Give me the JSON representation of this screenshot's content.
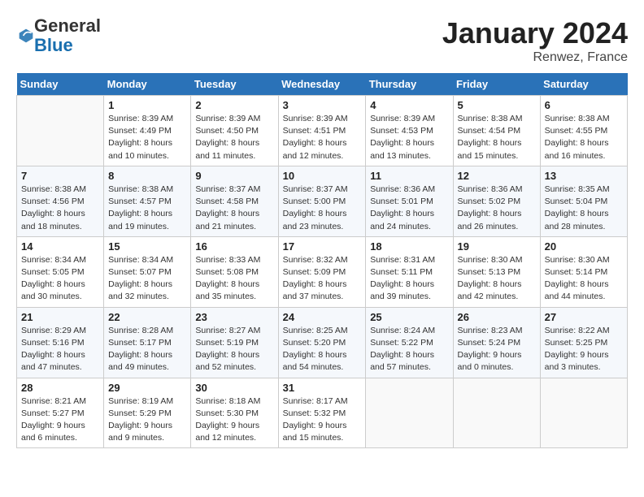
{
  "logo": {
    "general": "General",
    "blue": "Blue"
  },
  "header": {
    "month": "January 2024",
    "location": "Renwez, France"
  },
  "weekdays": [
    "Sunday",
    "Monday",
    "Tuesday",
    "Wednesday",
    "Thursday",
    "Friday",
    "Saturday"
  ],
  "weeks": [
    [
      {
        "day": "",
        "sunrise": "",
        "sunset": "",
        "daylight": ""
      },
      {
        "day": "1",
        "sunrise": "Sunrise: 8:39 AM",
        "sunset": "Sunset: 4:49 PM",
        "daylight": "Daylight: 8 hours and 10 minutes."
      },
      {
        "day": "2",
        "sunrise": "Sunrise: 8:39 AM",
        "sunset": "Sunset: 4:50 PM",
        "daylight": "Daylight: 8 hours and 11 minutes."
      },
      {
        "day": "3",
        "sunrise": "Sunrise: 8:39 AM",
        "sunset": "Sunset: 4:51 PM",
        "daylight": "Daylight: 8 hours and 12 minutes."
      },
      {
        "day": "4",
        "sunrise": "Sunrise: 8:39 AM",
        "sunset": "Sunset: 4:53 PM",
        "daylight": "Daylight: 8 hours and 13 minutes."
      },
      {
        "day": "5",
        "sunrise": "Sunrise: 8:38 AM",
        "sunset": "Sunset: 4:54 PM",
        "daylight": "Daylight: 8 hours and 15 minutes."
      },
      {
        "day": "6",
        "sunrise": "Sunrise: 8:38 AM",
        "sunset": "Sunset: 4:55 PM",
        "daylight": "Daylight: 8 hours and 16 minutes."
      }
    ],
    [
      {
        "day": "7",
        "sunrise": "Sunrise: 8:38 AM",
        "sunset": "Sunset: 4:56 PM",
        "daylight": "Daylight: 8 hours and 18 minutes."
      },
      {
        "day": "8",
        "sunrise": "Sunrise: 8:38 AM",
        "sunset": "Sunset: 4:57 PM",
        "daylight": "Daylight: 8 hours and 19 minutes."
      },
      {
        "day": "9",
        "sunrise": "Sunrise: 8:37 AM",
        "sunset": "Sunset: 4:58 PM",
        "daylight": "Daylight: 8 hours and 21 minutes."
      },
      {
        "day": "10",
        "sunrise": "Sunrise: 8:37 AM",
        "sunset": "Sunset: 5:00 PM",
        "daylight": "Daylight: 8 hours and 23 minutes."
      },
      {
        "day": "11",
        "sunrise": "Sunrise: 8:36 AM",
        "sunset": "Sunset: 5:01 PM",
        "daylight": "Daylight: 8 hours and 24 minutes."
      },
      {
        "day": "12",
        "sunrise": "Sunrise: 8:36 AM",
        "sunset": "Sunset: 5:02 PM",
        "daylight": "Daylight: 8 hours and 26 minutes."
      },
      {
        "day": "13",
        "sunrise": "Sunrise: 8:35 AM",
        "sunset": "Sunset: 5:04 PM",
        "daylight": "Daylight: 8 hours and 28 minutes."
      }
    ],
    [
      {
        "day": "14",
        "sunrise": "Sunrise: 8:34 AM",
        "sunset": "Sunset: 5:05 PM",
        "daylight": "Daylight: 8 hours and 30 minutes."
      },
      {
        "day": "15",
        "sunrise": "Sunrise: 8:34 AM",
        "sunset": "Sunset: 5:07 PM",
        "daylight": "Daylight: 8 hours and 32 minutes."
      },
      {
        "day": "16",
        "sunrise": "Sunrise: 8:33 AM",
        "sunset": "Sunset: 5:08 PM",
        "daylight": "Daylight: 8 hours and 35 minutes."
      },
      {
        "day": "17",
        "sunrise": "Sunrise: 8:32 AM",
        "sunset": "Sunset: 5:09 PM",
        "daylight": "Daylight: 8 hours and 37 minutes."
      },
      {
        "day": "18",
        "sunrise": "Sunrise: 8:31 AM",
        "sunset": "Sunset: 5:11 PM",
        "daylight": "Daylight: 8 hours and 39 minutes."
      },
      {
        "day": "19",
        "sunrise": "Sunrise: 8:30 AM",
        "sunset": "Sunset: 5:13 PM",
        "daylight": "Daylight: 8 hours and 42 minutes."
      },
      {
        "day": "20",
        "sunrise": "Sunrise: 8:30 AM",
        "sunset": "Sunset: 5:14 PM",
        "daylight": "Daylight: 8 hours and 44 minutes."
      }
    ],
    [
      {
        "day": "21",
        "sunrise": "Sunrise: 8:29 AM",
        "sunset": "Sunset: 5:16 PM",
        "daylight": "Daylight: 8 hours and 47 minutes."
      },
      {
        "day": "22",
        "sunrise": "Sunrise: 8:28 AM",
        "sunset": "Sunset: 5:17 PM",
        "daylight": "Daylight: 8 hours and 49 minutes."
      },
      {
        "day": "23",
        "sunrise": "Sunrise: 8:27 AM",
        "sunset": "Sunset: 5:19 PM",
        "daylight": "Daylight: 8 hours and 52 minutes."
      },
      {
        "day": "24",
        "sunrise": "Sunrise: 8:25 AM",
        "sunset": "Sunset: 5:20 PM",
        "daylight": "Daylight: 8 hours and 54 minutes."
      },
      {
        "day": "25",
        "sunrise": "Sunrise: 8:24 AM",
        "sunset": "Sunset: 5:22 PM",
        "daylight": "Daylight: 8 hours and 57 minutes."
      },
      {
        "day": "26",
        "sunrise": "Sunrise: 8:23 AM",
        "sunset": "Sunset: 5:24 PM",
        "daylight": "Daylight: 9 hours and 0 minutes."
      },
      {
        "day": "27",
        "sunrise": "Sunrise: 8:22 AM",
        "sunset": "Sunset: 5:25 PM",
        "daylight": "Daylight: 9 hours and 3 minutes."
      }
    ],
    [
      {
        "day": "28",
        "sunrise": "Sunrise: 8:21 AM",
        "sunset": "Sunset: 5:27 PM",
        "daylight": "Daylight: 9 hours and 6 minutes."
      },
      {
        "day": "29",
        "sunrise": "Sunrise: 8:19 AM",
        "sunset": "Sunset: 5:29 PM",
        "daylight": "Daylight: 9 hours and 9 minutes."
      },
      {
        "day": "30",
        "sunrise": "Sunrise: 8:18 AM",
        "sunset": "Sunset: 5:30 PM",
        "daylight": "Daylight: 9 hours and 12 minutes."
      },
      {
        "day": "31",
        "sunrise": "Sunrise: 8:17 AM",
        "sunset": "Sunset: 5:32 PM",
        "daylight": "Daylight: 9 hours and 15 minutes."
      },
      {
        "day": "",
        "sunrise": "",
        "sunset": "",
        "daylight": ""
      },
      {
        "day": "",
        "sunrise": "",
        "sunset": "",
        "daylight": ""
      },
      {
        "day": "",
        "sunrise": "",
        "sunset": "",
        "daylight": ""
      }
    ]
  ]
}
